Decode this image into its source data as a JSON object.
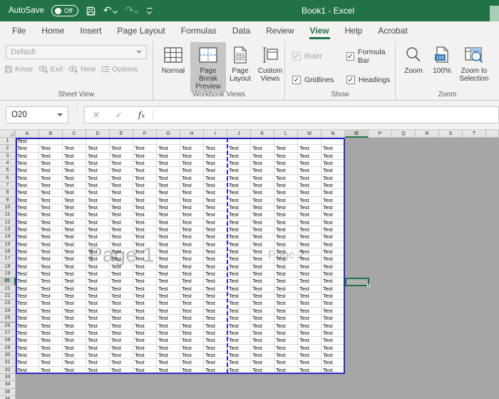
{
  "title_bar": {
    "autosave_label": "AutoSave",
    "autosave_state": "Off",
    "window_title": "Book1 - Excel"
  },
  "tabs": [
    {
      "label": "File"
    },
    {
      "label": "Home"
    },
    {
      "label": "Insert"
    },
    {
      "label": "Page Layout"
    },
    {
      "label": "Formulas"
    },
    {
      "label": "Data"
    },
    {
      "label": "Review"
    },
    {
      "label": "View",
      "selected": true
    },
    {
      "label": "Help"
    },
    {
      "label": "Acrobat"
    }
  ],
  "ribbon": {
    "sheet_view": {
      "group_label": "Sheet View",
      "dropdown_value": "Default",
      "keep_label": "Keep",
      "exit_label": "Exit",
      "new_label": "New",
      "options_label": "Options"
    },
    "workbook_views": {
      "group_label": "Workbook Views",
      "normal_label": "Normal",
      "page_break_preview_label": "Page Break Preview",
      "page_layout_label": "Page Layout",
      "custom_views_label": "Custom Views",
      "selected_view": "Page Break Preview"
    },
    "show": {
      "group_label": "Show",
      "checkboxes": [
        {
          "label": "Ruler",
          "checked": true,
          "disabled": true
        },
        {
          "label": "Formula Bar",
          "checked": true,
          "disabled": false
        },
        {
          "label": "Gridlines",
          "checked": true,
          "disabled": false
        },
        {
          "label": "Headings",
          "checked": true,
          "disabled": false
        }
      ]
    },
    "zoom": {
      "group_label": "Zoom",
      "zoom_label": "Zoom",
      "pct_label": "100%",
      "zoom_to_selection_label": "Zoom to Selection"
    }
  },
  "formula_bar": {
    "name_box_value": "O20",
    "formula_value": ""
  },
  "grid": {
    "columns": [
      "A",
      "B",
      "C",
      "D",
      "E",
      "F",
      "G",
      "H",
      "I",
      "J",
      "K",
      "L",
      "M",
      "N",
      "O",
      "P",
      "Q",
      "R",
      "S",
      "T"
    ],
    "visible_rows": 36,
    "cell_text": "Test",
    "filled": {
      "first_row_filled_cols": 1,
      "body_row_from": 2,
      "body_row_to": 32,
      "body_col_count": 14
    },
    "print_area": {
      "col_count": 14,
      "row_count": 32
    },
    "page_break_after_col_index": 9,
    "pages": [
      {
        "label": "Page 1",
        "col_from": 0,
        "col_to": 9
      },
      {
        "label": "Page 2",
        "col_from": 9,
        "col_to": 14
      }
    ],
    "selected_cell": "O20"
  },
  "icons": {
    "save": "save-icon",
    "undo": "undo-icon",
    "redo": "redo-icon",
    "customize": "customize-qat-icon",
    "keep": "disk-icon",
    "exit": "eye-x-icon",
    "new": "eye-plus-icon",
    "options": "list-icon",
    "normal": "grid-icon",
    "page_break": "page-break-grid-icon",
    "page_layout": "page-layout-icon",
    "custom_views": "custom-views-icon",
    "zoom": "magnifier-icon",
    "pct": "zoom-100-icon",
    "zts": "zoom-selection-icon"
  },
  "colors": {
    "accent_green": "#217346",
    "page_break_blue": "#2b2bd0",
    "outside_area_gray": "#a6a6a6",
    "selected_button_bg": "#c8c6c4",
    "watermark_gray": "#7f7f7f"
  }
}
